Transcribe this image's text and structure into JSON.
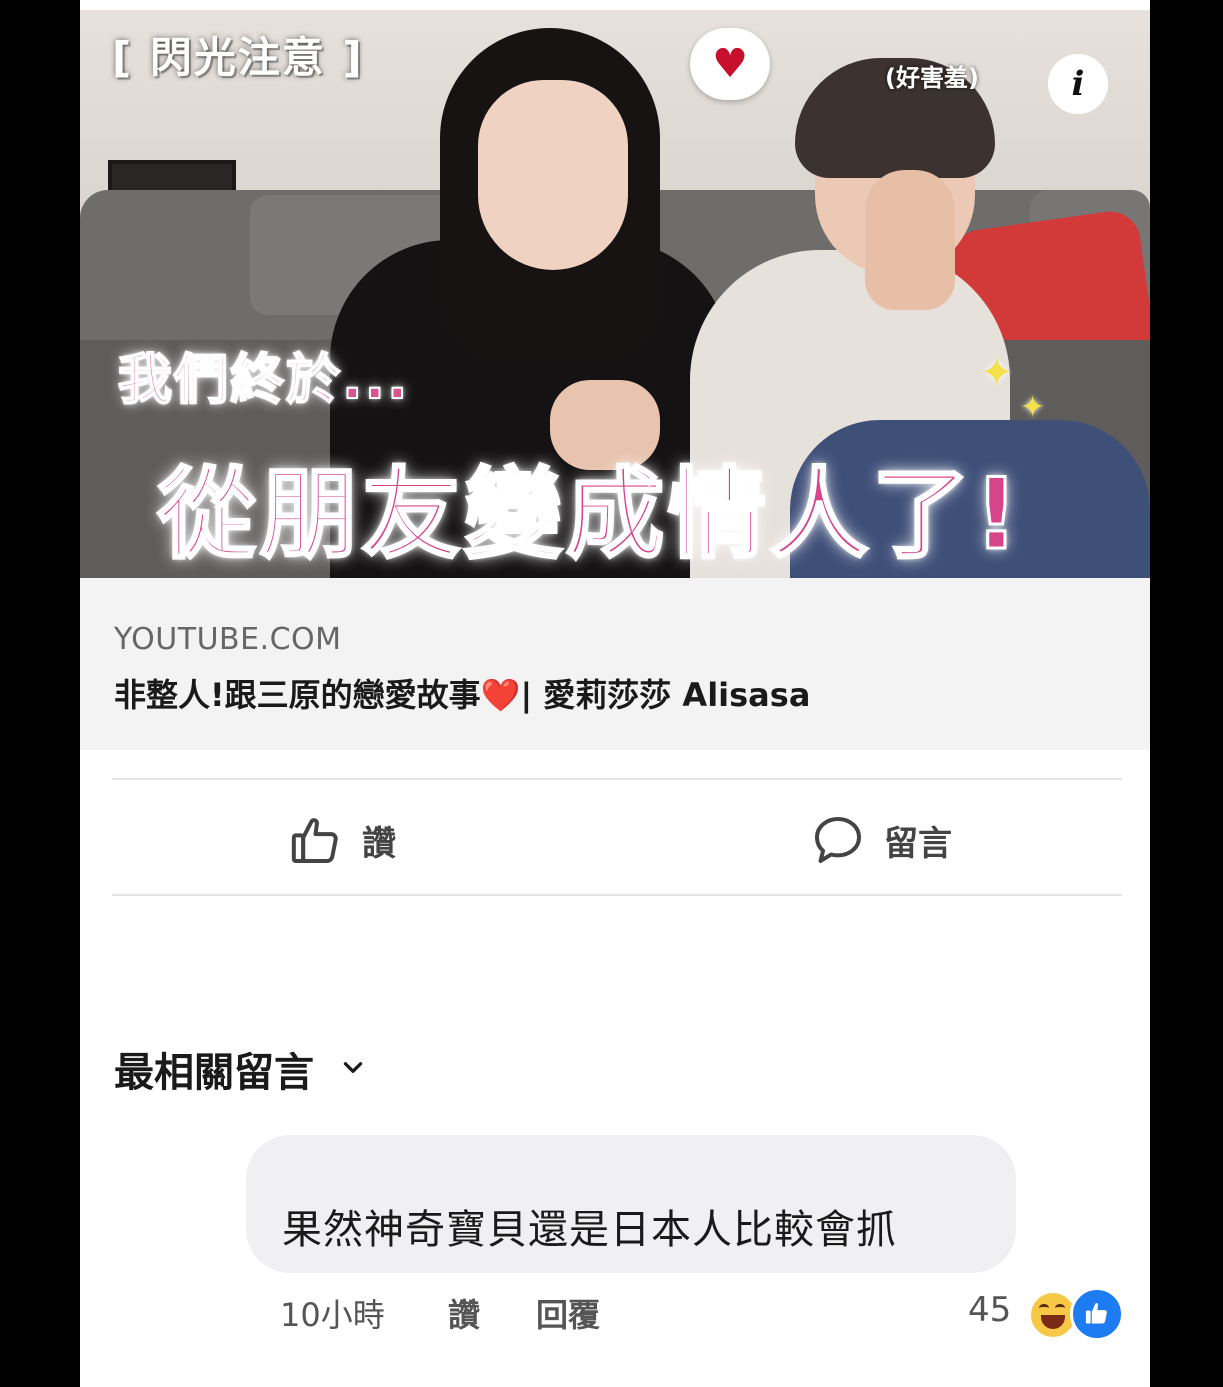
{
  "thumbnail": {
    "flash_label": "[ 閃光注意 ]",
    "shy_label": "(好害羞)",
    "info_glyph": "i",
    "overlay_line1": "我們終於...",
    "overlay_line2": "從朋友變成情人了!",
    "heart_icon": "heart-icon"
  },
  "link_preview": {
    "domain": "YOUTUBE.COM",
    "title_part1": "非整人!跟三原的戀愛故事",
    "title_part2": "| 愛莉莎莎 Alisasa"
  },
  "actions": {
    "like_label": "讚",
    "comment_label": "留言"
  },
  "comments": {
    "sort_label": "最相關留言",
    "items": [
      {
        "text": "果然神奇寶貝還是日本人比較會抓",
        "time": "10小時",
        "like_label": "讚",
        "reply_label": "回覆",
        "reaction_count": "45"
      }
    ]
  },
  "colors": {
    "overlay_pink": "#d7448a",
    "like_blue": "#1d7cf2",
    "haha_yellow": "#f7c846"
  }
}
